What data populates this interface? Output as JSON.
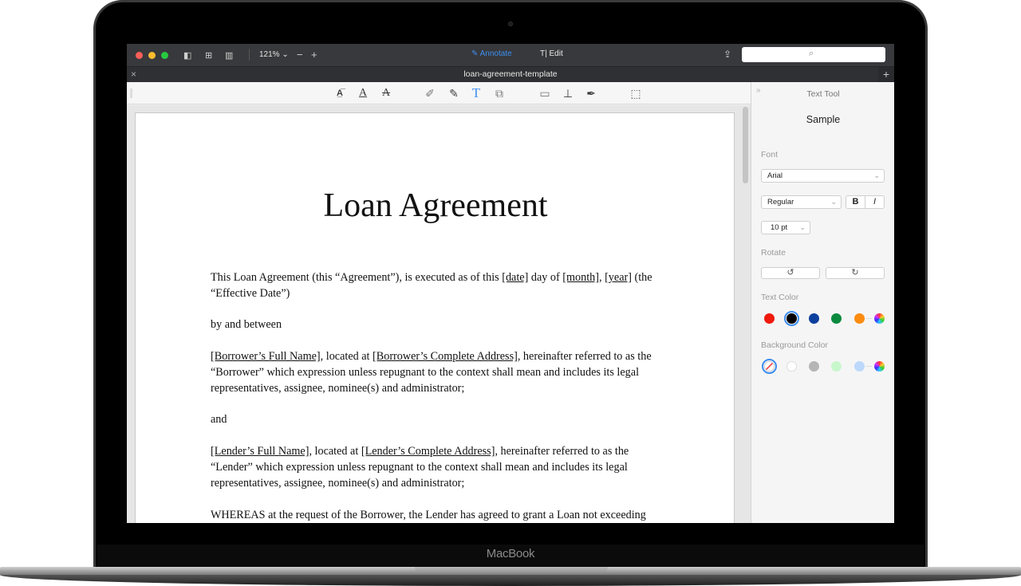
{
  "device": {
    "brand": "MacBook"
  },
  "window": {
    "zoom_level": "121%",
    "zoom_out_symbol": "−",
    "zoom_in_symbol": "+",
    "modes": [
      {
        "label": "Annotate",
        "active": true,
        "color": "#3d8ef0"
      },
      {
        "label": "Edit",
        "active": false
      }
    ],
    "search_placeholder": "",
    "tab_close": "×",
    "tab_add": "+",
    "document_title": "loan-agreement-template"
  },
  "toolbar": {
    "tools": [
      "text-highlight",
      "underline",
      "strikethrough",
      "pencil",
      "highlighter",
      "text-tool",
      "shapes",
      "note",
      "stamp",
      "signature",
      "selection"
    ],
    "active_tool": "text-tool"
  },
  "document": {
    "title": "Loan Agreement",
    "p1": {
      "a": "This Loan Agreement (this “Agreement”), is executed as of this ",
      "date": "[date]",
      "b": " day of ",
      "month": "[month]",
      "c": ", ",
      "year": "[year]",
      "d": " (the “Effective Date”)"
    },
    "p2": "by and between",
    "p3": {
      "a": "[Borrower’s Full Name]",
      "b": ", located at ",
      "c": "[Borrower’s Complete Address]",
      "d": ", hereinafter referred to as the “Borrower” which expression unless repugnant to the context shall mean and includes its legal representatives, assignee, nominee(s) and administrator;"
    },
    "p4": "and",
    "p5": {
      "a": "[Lender’s Full Name]",
      "b": ", located at ",
      "c": "[Lender’s Complete Address]",
      "d": ", hereinafter referred to as the “Lender” which expression unless repugnant to the context shall mean and includes its legal representatives, assignee, nominee(s) and administrator;"
    },
    "p6": "WHEREAS at the request of the Borrower, the Lender has agreed to grant a Loan not exceeding"
  },
  "panel": {
    "title": "Text Tool",
    "sample": "Sample",
    "font_label": "Font",
    "font_value": "Arial",
    "style_value": "Regular",
    "bold_label": "B",
    "italic_label": "I",
    "size_value": "10 pt",
    "rotate_label": "Rotate",
    "text_color_label": "Text Color",
    "text_colors": [
      "#f0190c",
      "#000000",
      "#0d3f9e",
      "#0b8a3e",
      "#fb8c0f"
    ],
    "text_color_selected": "#000000",
    "background_color_label": "Background Color",
    "background_colors": [
      "none",
      "#ffffff",
      "#b5b5b5",
      "#c9f7cc",
      "#bcd9fb"
    ],
    "background_color_selected": "none"
  }
}
